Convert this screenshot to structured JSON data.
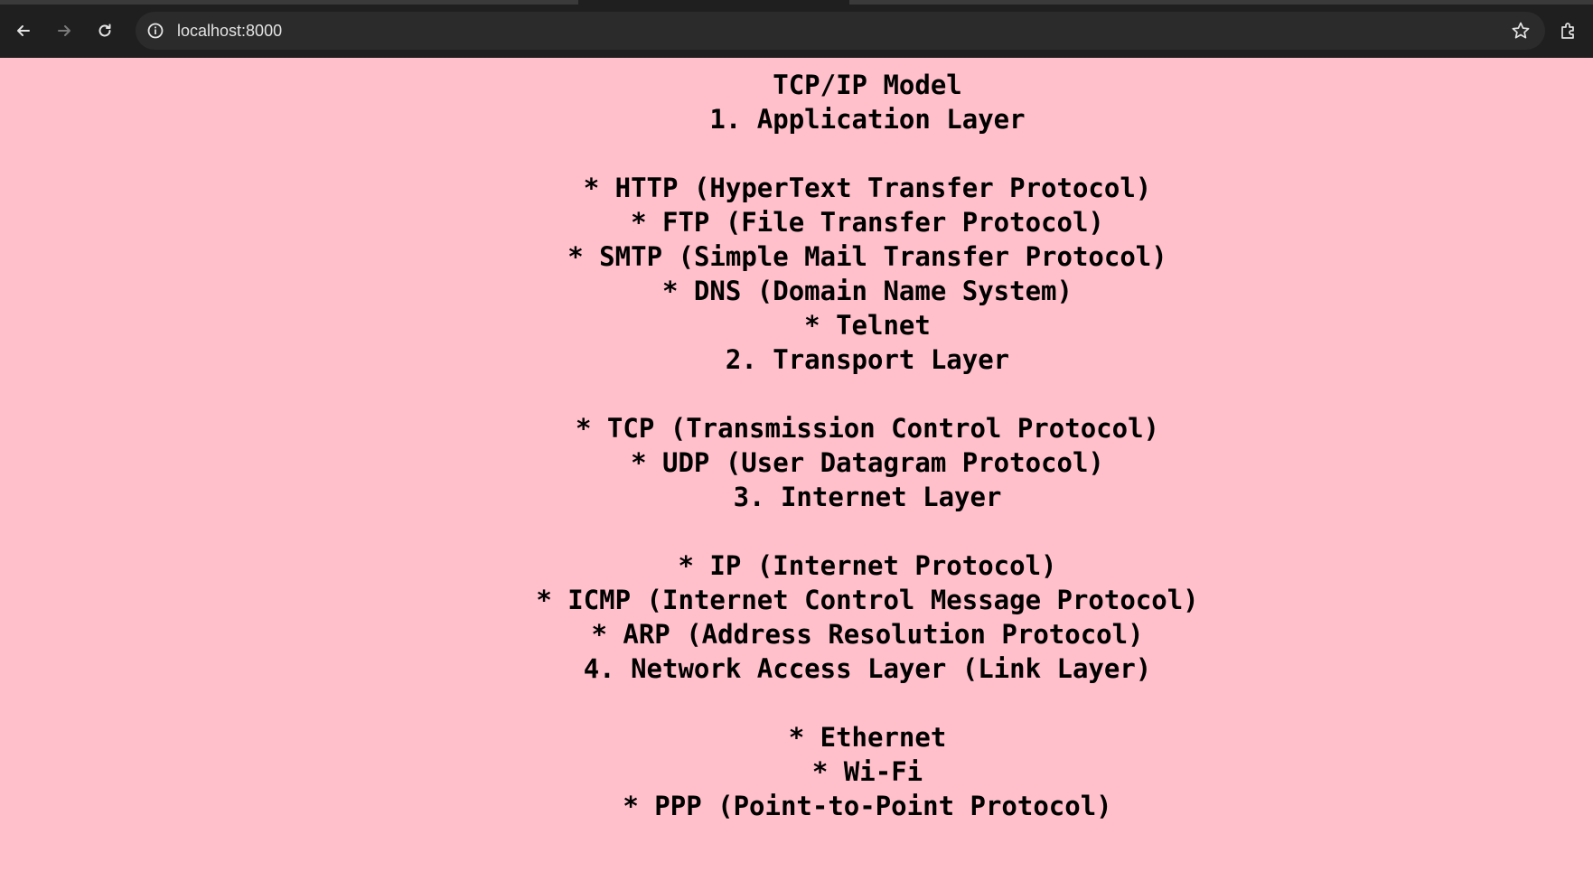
{
  "browser": {
    "url": "localhost:8000",
    "icons": {
      "back": "back-arrow-icon",
      "forward": "forward-arrow-icon",
      "reload": "reload-icon",
      "site_info": "info-icon",
      "bookmark": "star-icon",
      "extensions": "extensions-icon"
    }
  },
  "page": {
    "background_color": "#ffc0cb",
    "title": "TCP/IP Model",
    "sections": [
      {
        "heading": "1. Application Layer",
        "items": [
          "* HTTP (HyperText Transfer Protocol)",
          "* FTP (File Transfer Protocol)",
          "* SMTP (Simple Mail Transfer Protocol)",
          "* DNS (Domain Name System)",
          "* Telnet"
        ]
      },
      {
        "heading": "2. Transport Layer",
        "items": [
          "* TCP (Transmission Control Protocol)",
          "* UDP (User Datagram Protocol)"
        ]
      },
      {
        "heading": "3. Internet Layer",
        "items": [
          "* IP (Internet Protocol)",
          "* ICMP (Internet Control Message Protocol)",
          "* ARP (Address Resolution Protocol)"
        ]
      },
      {
        "heading": "4. Network Access Layer (Link Layer)",
        "items": [
          "* Ethernet",
          "* Wi-Fi",
          "* PPP (Point-to-Point Protocol)"
        ]
      }
    ]
  }
}
